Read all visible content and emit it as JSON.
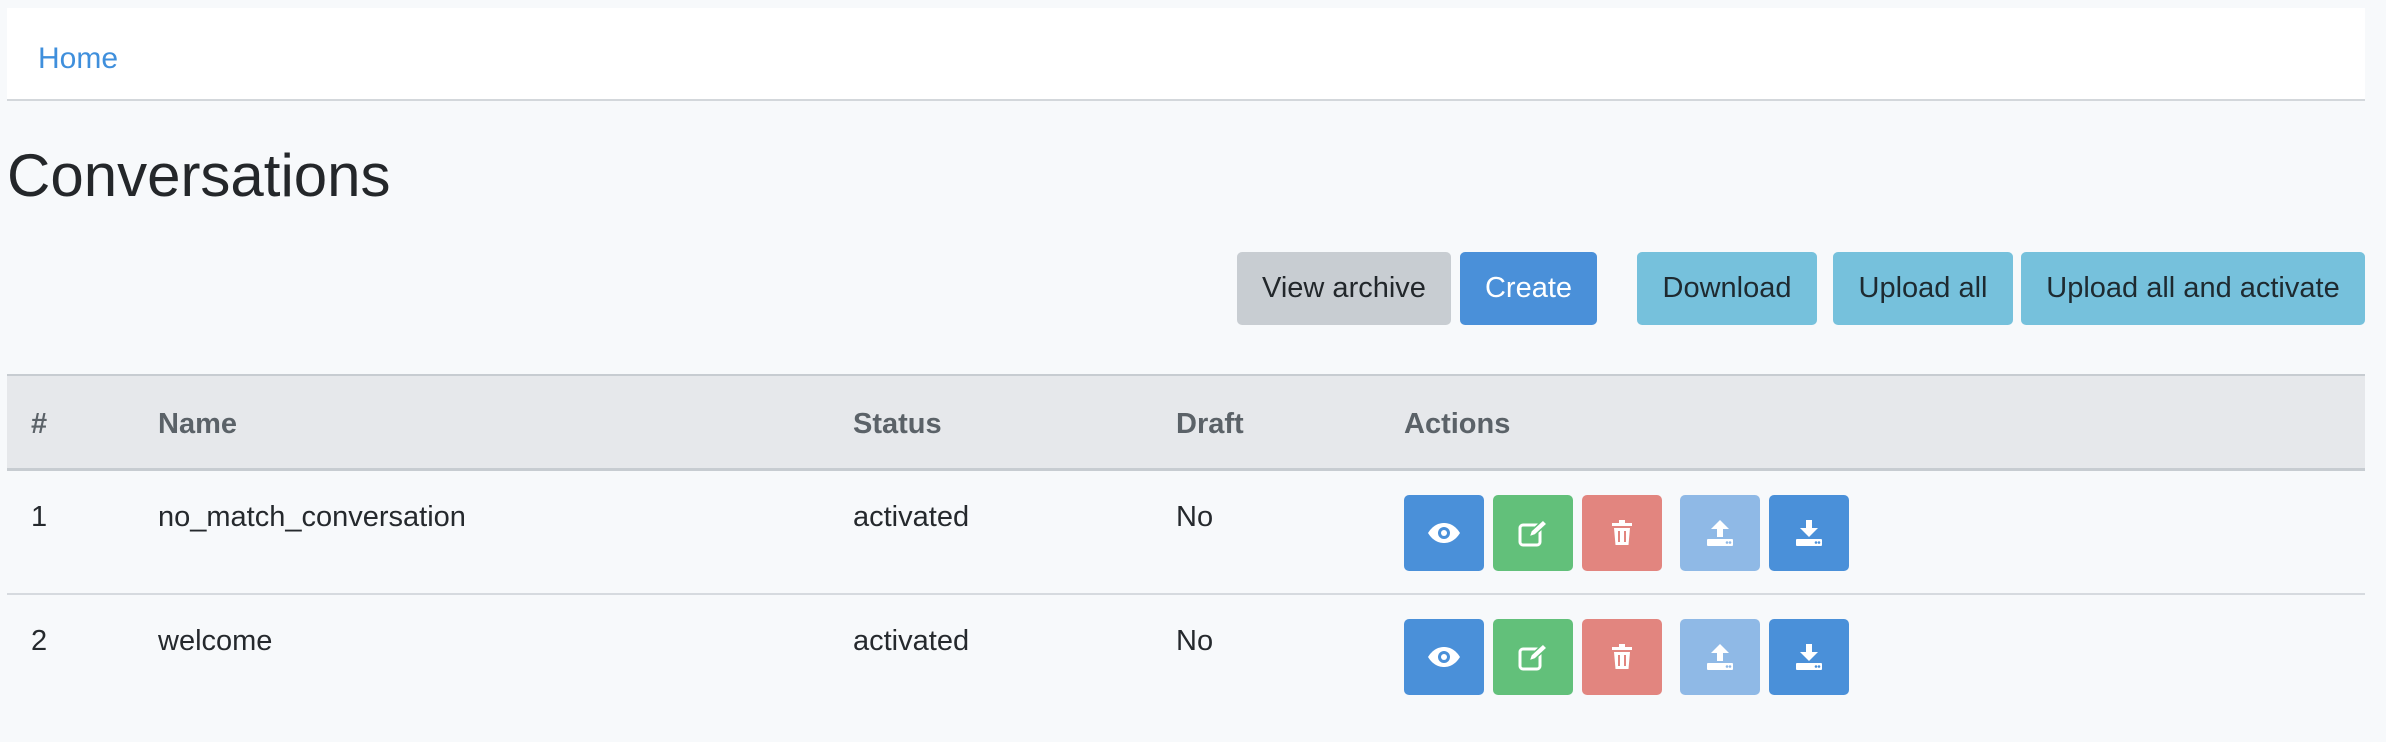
{
  "nav": {
    "home_label": "Home"
  },
  "page": {
    "title": "Conversations"
  },
  "toolbar": {
    "view_archive": "View archive",
    "create": "Create",
    "download": "Download",
    "upload_all": "Upload all",
    "upload_all_activate": "Upload all and activate"
  },
  "table": {
    "headers": {
      "num": "#",
      "name": "Name",
      "status": "Status",
      "draft": "Draft",
      "actions": "Actions"
    },
    "rows": [
      {
        "num": "1",
        "name": "no_match_conversation",
        "status": "activated",
        "draft": "No"
      },
      {
        "num": "2",
        "name": "welcome",
        "status": "activated",
        "draft": "No"
      }
    ],
    "action_icons": [
      "eye-icon",
      "edit-icon",
      "trash-icon",
      "upload-icon",
      "download-icon"
    ]
  },
  "colors": {
    "primary": "#4a90d9",
    "success": "#62c07a",
    "danger": "#e2857f",
    "info": "#76c1dc",
    "secondary": "#c8cdd2",
    "link": "#3f8fdc"
  }
}
